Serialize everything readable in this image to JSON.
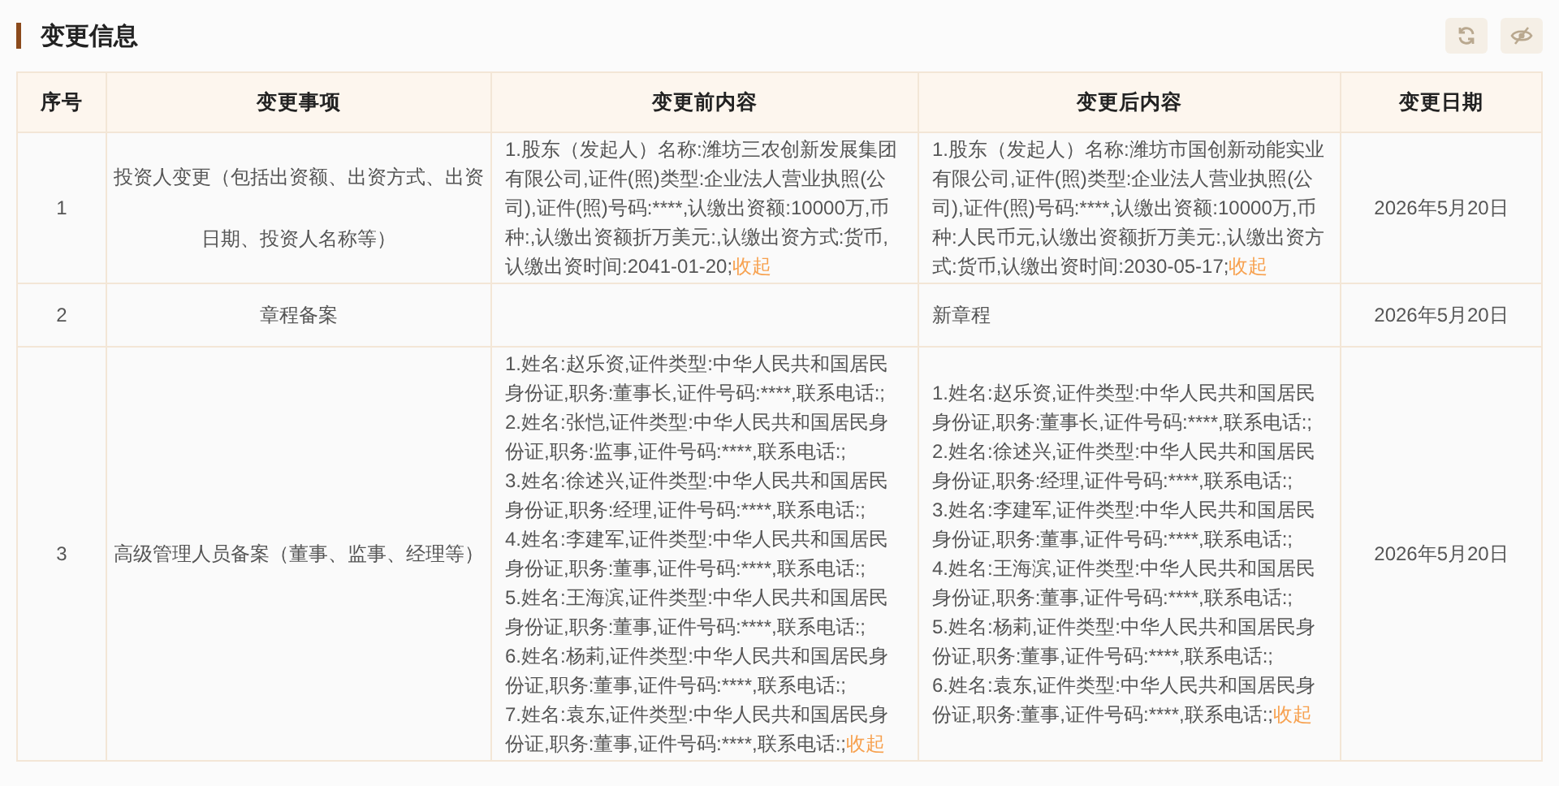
{
  "section": {
    "title": "变更信息"
  },
  "table": {
    "columns": [
      "序号",
      "变更事项",
      "变更前内容",
      "变更后内容",
      "变更日期"
    ],
    "rows": [
      {
        "index": "1",
        "item": "投资人变更（包括出资额、出资方式、出资日期、投资人名称等）",
        "before": {
          "lines": [
            "1.股东（发起人）名称:潍坊三农创新发展集团有限公司,证件(照)类型:企业法人营业执照(公司),证件(照)号码:****,认缴出资额:10000万,币种:,认缴出资额折万美元:,认缴出资方式:货币,认缴出资时间:2041-01-20;"
          ],
          "toggle": "收起"
        },
        "after": {
          "lines": [
            "1.股东（发起人）名称:潍坊市国创新动能实业有限公司,证件(照)类型:企业法人营业执照(公司),证件(照)号码:****,认缴出资额:10000万,币种:人民币元,认缴出资额折万美元:,认缴出资方式:货币,认缴出资时间:2030-05-17;"
          ],
          "toggle": "收起"
        },
        "date": "2026年5月20日"
      },
      {
        "index": "2",
        "item": "章程备案",
        "before": {},
        "after": {
          "lines": [
            "新章程"
          ]
        },
        "date": "2026年5月20日"
      },
      {
        "index": "3",
        "item": "高级管理人员备案（董事、监事、经理等）",
        "before": {
          "lines": [
            "1.姓名:赵乐资,证件类型:中华人民共和国居民身份证,职务:董事长,证件号码:****,联系电话:;",
            "2.姓名:张恺,证件类型:中华人民共和国居民身份证,职务:监事,证件号码:****,联系电话:;",
            "3.姓名:徐述兴,证件类型:中华人民共和国居民身份证,职务:经理,证件号码:****,联系电话:;",
            "4.姓名:李建军,证件类型:中华人民共和国居民身份证,职务:董事,证件号码:****,联系电话:;",
            "5.姓名:王海滨,证件类型:中华人民共和国居民身份证,职务:董事,证件号码:****,联系电话:;",
            "6.姓名:杨莉,证件类型:中华人民共和国居民身份证,职务:董事,证件号码:****,联系电话:;",
            "7.姓名:袁东,证件类型:中华人民共和国居民身份证,职务:董事,证件号码:****,联系电话:;"
          ],
          "toggle": "收起"
        },
        "after": {
          "lines": [
            "1.姓名:赵乐资,证件类型:中华人民共和国居民身份证,职务:董事长,证件号码:****,联系电话:;",
            "2.姓名:徐述兴,证件类型:中华人民共和国居民身份证,职务:经理,证件号码:****,联系电话:;",
            "3.姓名:李建军,证件类型:中华人民共和国居民身份证,职务:董事,证件号码:****,联系电话:;",
            "4.姓名:王海滨,证件类型:中华人民共和国居民身份证,职务:董事,证件号码:****,联系电话:;",
            "5.姓名:杨莉,证件类型:中华人民共和国居民身份证,职务:董事,证件号码:****,联系电话:;",
            "6.姓名:袁东,证件类型:中华人民共和国居民身份证,职务:董事,证件号码:****,联系电话:;"
          ],
          "toggle": "收起"
        },
        "date": "2026年5月20日"
      }
    ]
  }
}
